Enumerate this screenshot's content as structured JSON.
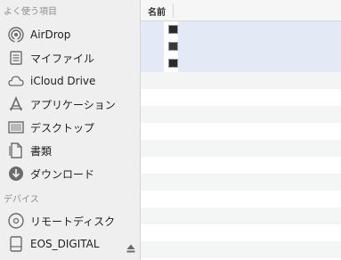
{
  "sidebar": {
    "favorites_header": "よく使う項目",
    "devices_header": "デバイス",
    "items": [
      {
        "label": "AirDrop",
        "icon": "airdrop-icon"
      },
      {
        "label": "マイファイル",
        "icon": "all-my-files-icon"
      },
      {
        "label": "iCloud Drive",
        "icon": "cloud-icon"
      },
      {
        "label": "アプリケーション",
        "icon": "applications-icon"
      },
      {
        "label": "デスクトップ",
        "icon": "desktop-icon"
      },
      {
        "label": "書類",
        "icon": "documents-icon"
      },
      {
        "label": "ダウンロード",
        "icon": "downloads-icon"
      }
    ],
    "devices": [
      {
        "label": "リモートディスク",
        "icon": "disc-icon"
      },
      {
        "label": "EOS_DIGITAL",
        "icon": "drive-icon",
        "ejectable": true
      }
    ]
  },
  "file_list": {
    "column_header": "名前",
    "selected_rows": 3,
    "selection_color": "#e3e9f5"
  }
}
